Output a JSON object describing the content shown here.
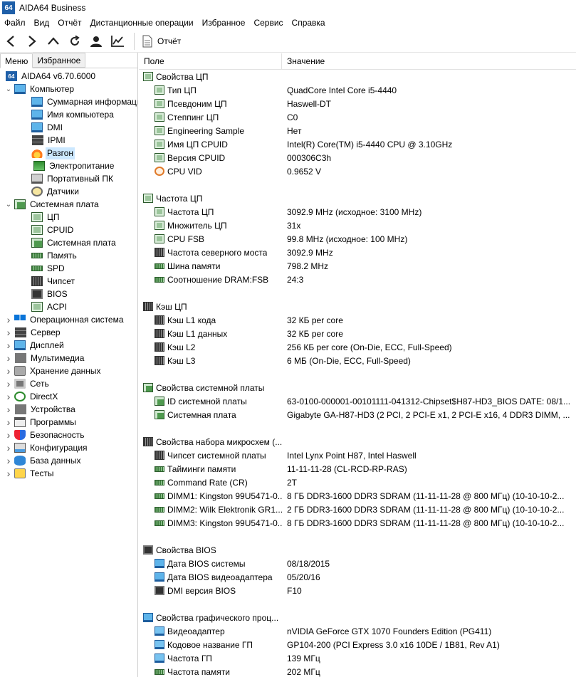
{
  "window": {
    "title": "AIDA64 Business",
    "app_icon_text": "64"
  },
  "menu": [
    "Файл",
    "Вид",
    "Отчёт",
    "Дистанционные операции",
    "Избранное",
    "Сервис",
    "Справка"
  ],
  "toolbar": {
    "report_label": "Отчёт"
  },
  "tabs": {
    "menu": "Меню",
    "favorites": "Избранное"
  },
  "tree": [
    {
      "label": "AIDA64 v6.70.6000",
      "icon": "aida64-icon",
      "level": 0,
      "expander": ""
    },
    {
      "label": "Компьютер",
      "icon": "monitor-icon",
      "level": 0,
      "expander": "v"
    },
    {
      "label": "Суммарная информация",
      "icon": "monitor-icon",
      "level": 1,
      "expander": ""
    },
    {
      "label": "Имя компьютера",
      "icon": "monitor-icon",
      "level": 1,
      "expander": ""
    },
    {
      "label": "DMI",
      "icon": "monitor-icon",
      "level": 1,
      "expander": ""
    },
    {
      "label": "IPMI",
      "icon": "server-icon",
      "level": 1,
      "expander": ""
    },
    {
      "label": "Разгон",
      "icon": "flame-icon",
      "level": 1,
      "expander": "",
      "selected": true
    },
    {
      "label": "Электропитание",
      "icon": "battery-icon",
      "level": 1,
      "expander": ""
    },
    {
      "label": "Портативный ПК",
      "icon": "laptop-icon",
      "level": 1,
      "expander": ""
    },
    {
      "label": "Датчики",
      "icon": "gauge-icon",
      "level": 1,
      "expander": ""
    },
    {
      "label": "Системная плата",
      "icon": "motherboard-icon",
      "level": 0,
      "expander": "v"
    },
    {
      "label": "ЦП",
      "icon": "chip-icon",
      "level": 1,
      "expander": ""
    },
    {
      "label": "CPUID",
      "icon": "chip-icon",
      "level": 1,
      "expander": ""
    },
    {
      "label": "Системная плата",
      "icon": "motherboard-icon",
      "level": 1,
      "expander": ""
    },
    {
      "label": "Память",
      "icon": "ram-icon",
      "level": 1,
      "expander": ""
    },
    {
      "label": "SPD",
      "icon": "ram-icon",
      "level": 1,
      "expander": ""
    },
    {
      "label": "Чипсет",
      "icon": "chipset-icon",
      "level": 1,
      "expander": ""
    },
    {
      "label": "BIOS",
      "icon": "bios-icon",
      "level": 1,
      "expander": ""
    },
    {
      "label": "ACPI",
      "icon": "chip-icon",
      "level": 1,
      "expander": ""
    },
    {
      "label": "Операционная система",
      "icon": "windows-icon",
      "level": 0,
      "expander": ">"
    },
    {
      "label": "Сервер",
      "icon": "server-icon",
      "level": 0,
      "expander": ">"
    },
    {
      "label": "Дисплей",
      "icon": "monitor-icon",
      "level": 0,
      "expander": ">"
    },
    {
      "label": "Мультимедиа",
      "icon": "speaker-icon",
      "level": 0,
      "expander": ">"
    },
    {
      "label": "Хранение данных",
      "icon": "disk-icon",
      "level": 0,
      "expander": ">"
    },
    {
      "label": "Сеть",
      "icon": "network-icon",
      "level": 0,
      "expander": ">"
    },
    {
      "label": "DirectX",
      "icon": "xbox-icon",
      "level": 0,
      "expander": ">"
    },
    {
      "label": "Устройства",
      "icon": "device-icon",
      "level": 0,
      "expander": ">"
    },
    {
      "label": "Программы",
      "icon": "programs-icon",
      "level": 0,
      "expander": ">"
    },
    {
      "label": "Безопасность",
      "icon": "shield-icon",
      "level": 0,
      "expander": ">"
    },
    {
      "label": "Конфигурация",
      "icon": "config-icon",
      "level": 0,
      "expander": ">"
    },
    {
      "label": "База данных",
      "icon": "database-icon",
      "level": 0,
      "expander": ">"
    },
    {
      "label": "Тесты",
      "icon": "test-icon",
      "level": 0,
      "expander": ">"
    }
  ],
  "columns": {
    "field": "Поле",
    "value": "Значение"
  },
  "sections": [
    {
      "title": "Свойства ЦП",
      "icon": "chip-icon",
      "rows": [
        {
          "field": "Тип ЦП",
          "value": "QuadCore Intel Core i5-4440",
          "icon": "chip-icon"
        },
        {
          "field": "Псевдоним ЦП",
          "value": "Haswell-DT",
          "icon": "chip-icon"
        },
        {
          "field": "Степпинг ЦП",
          "value": "C0",
          "icon": "chip-icon"
        },
        {
          "field": "Engineering Sample",
          "value": "Нет",
          "icon": "chip-icon"
        },
        {
          "field": "Имя ЦП CPUID",
          "value": "Intel(R) Core(TM) i5-4440 CPU @ 3.10GHz",
          "icon": "chip-icon"
        },
        {
          "field": "Версия CPUID",
          "value": "000306C3h",
          "icon": "chip-icon"
        },
        {
          "field": "CPU VID",
          "value": "0.9652 V",
          "icon": "cpu-vid-icon"
        }
      ]
    },
    {
      "title": "Частота ЦП",
      "icon": "chip-icon",
      "rows": [
        {
          "field": "Частота ЦП",
          "value": "3092.9 MHz  (исходное: 3100 MHz)",
          "icon": "chip-icon"
        },
        {
          "field": "Множитель ЦП",
          "value": "31x",
          "icon": "chip-icon"
        },
        {
          "field": "CPU FSB",
          "value": "99.8 MHz  (исходное: 100 MHz)",
          "icon": "chip-icon"
        },
        {
          "field": "Частота северного моста",
          "value": "3092.9 MHz",
          "icon": "chipset-icon"
        },
        {
          "field": "Шина памяти",
          "value": "798.2 MHz",
          "icon": "ram-icon"
        },
        {
          "field": "Соотношение DRAM:FSB",
          "value": "24:3",
          "icon": "ram-icon"
        }
      ]
    },
    {
      "title": "Кэш ЦП",
      "icon": "chipset-icon",
      "rows": [
        {
          "field": "Кэш L1 кода",
          "value": "32 КБ per core",
          "icon": "chipset-icon"
        },
        {
          "field": "Кэш L1 данных",
          "value": "32 КБ per core",
          "icon": "chipset-icon"
        },
        {
          "field": "Кэш L2",
          "value": "256 КБ per core  (On-Die, ECC, Full-Speed)",
          "icon": "chipset-icon"
        },
        {
          "field": "Кэш L3",
          "value": "6 МБ  (On-Die, ECC, Full-Speed)",
          "icon": "chipset-icon"
        }
      ]
    },
    {
      "title": "Свойства системной платы",
      "icon": "motherboard-icon",
      "rows": [
        {
          "field": "ID системной платы",
          "value": "63-0100-000001-00101111-041312-Chipset$H87-HD3_BIOS DATE: 08/1...",
          "icon": "motherboard-icon"
        },
        {
          "field": "Системная плата",
          "value": "Gigabyte GA-H87-HD3  (2 PCI, 2 PCI-E x1, 2 PCI-E x16, 4 DDR3 DIMM, ...",
          "icon": "motherboard-icon"
        }
      ]
    },
    {
      "title": "Свойства набора микросхем (...",
      "icon": "chipset-icon",
      "rows": [
        {
          "field": "Чипсет системной платы",
          "value": "Intel Lynx Point H87, Intel Haswell",
          "icon": "chipset-icon"
        },
        {
          "field": "Тайминги памяти",
          "value": "11-11-11-28  (CL-RCD-RP-RAS)",
          "icon": "ram-icon"
        },
        {
          "field": "Command Rate (CR)",
          "value": "2T",
          "icon": "ram-icon"
        },
        {
          "field": "DIMM1: Kingston 99U5471-0...",
          "value": "8 ГБ DDR3-1600 DDR3 SDRAM  (11-11-11-28 @ 800 МГц)  (10-10-10-2...",
          "icon": "ram-icon"
        },
        {
          "field": "DIMM2: Wilk Elektronik GR1...",
          "value": "2 ГБ DDR3-1600 DDR3 SDRAM  (11-11-11-28 @ 800 МГц)  (10-10-10-2...",
          "icon": "ram-icon"
        },
        {
          "field": "DIMM3: Kingston 99U5471-0...",
          "value": "8 ГБ DDR3-1600 DDR3 SDRAM  (11-11-11-28 @ 800 МГц)  (10-10-10-2...",
          "icon": "ram-icon"
        }
      ]
    },
    {
      "title": "Свойства BIOS",
      "icon": "bios-icon",
      "rows": [
        {
          "field": "Дата BIOS системы",
          "value": "08/18/2015",
          "icon": "monitor-icon"
        },
        {
          "field": "Дата BIOS видеоадаптера",
          "value": "05/20/16",
          "icon": "monitor-icon"
        },
        {
          "field": "DMI версия BIOS",
          "value": "F10",
          "icon": "bios-icon"
        }
      ]
    },
    {
      "title": "Свойства графического проц...",
      "icon": "monitor-icon",
      "rows": [
        {
          "field": "Видеоадаптер",
          "value": "nVIDIA GeForce GTX 1070 Founders Edition (PG411)",
          "icon": "gpu-icon"
        },
        {
          "field": "Кодовое название ГП",
          "value": "GP104-200  (PCI Express 3.0 x16 10DE / 1B81, Rev A1)",
          "icon": "gpu-icon"
        },
        {
          "field": "Частота ГП",
          "value": "139 МГц",
          "icon": "gpu-icon"
        },
        {
          "field": "Частота памяти",
          "value": "202 МГц",
          "icon": "ram-icon"
        }
      ]
    }
  ]
}
